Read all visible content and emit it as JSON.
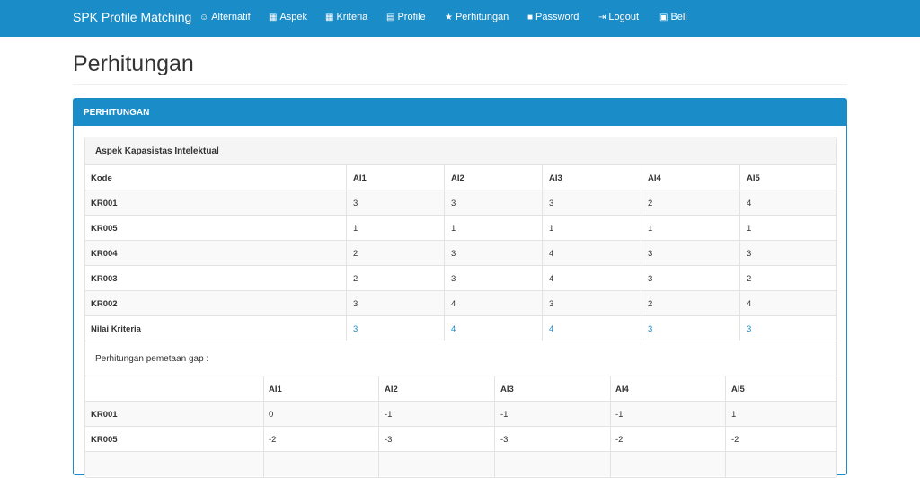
{
  "navbar": {
    "brand": "SPK Profile Matching",
    "items": [
      {
        "icon": "user-icon",
        "glyph": "☺",
        "label": "Alternatif"
      },
      {
        "icon": "grid-icon",
        "glyph": "▦",
        "label": "Aspek"
      },
      {
        "icon": "th-icon",
        "glyph": "▦",
        "label": "Kriteria"
      },
      {
        "icon": "profile-icon",
        "glyph": "▤",
        "label": "Profile"
      },
      {
        "icon": "star-icon",
        "glyph": "★",
        "label": "Perhitungan"
      },
      {
        "icon": "lock-icon",
        "glyph": "■",
        "label": "Password"
      },
      {
        "icon": "logout-icon",
        "glyph": "⇥",
        "label": "Logout"
      },
      {
        "icon": "cart-icon",
        "glyph": "▣",
        "label": "Beli"
      }
    ]
  },
  "page": {
    "title": "Perhitungan"
  },
  "panel": {
    "heading": "PERHITUNGAN",
    "section_title": "Aspek Kapasistas Intelektual",
    "table1": {
      "headers": [
        "Kode",
        "AI1",
        "AI2",
        "AI3",
        "AI4",
        "AI5"
      ],
      "rows": [
        {
          "kode": "KR001",
          "values": [
            "3",
            "3",
            "3",
            "2",
            "4"
          ]
        },
        {
          "kode": "KR005",
          "values": [
            "1",
            "1",
            "1",
            "1",
            "1"
          ]
        },
        {
          "kode": "KR004",
          "values": [
            "2",
            "3",
            "4",
            "3",
            "3"
          ]
        },
        {
          "kode": "KR003",
          "values": [
            "2",
            "3",
            "4",
            "3",
            "2"
          ]
        },
        {
          "kode": "KR002",
          "values": [
            "3",
            "4",
            "3",
            "2",
            "4"
          ]
        }
      ],
      "nilai": {
        "label": "Nilai Kriteria",
        "values": [
          "3",
          "4",
          "4",
          "3",
          "3"
        ]
      }
    },
    "gap_label": "Perhitungan pemetaan gap :",
    "table2": {
      "headers": [
        "",
        "AI1",
        "AI2",
        "AI3",
        "AI4",
        "AI5"
      ],
      "rows": [
        {
          "kode": "KR001",
          "values": [
            "0",
            "-1",
            "-1",
            "-1",
            "1"
          ]
        },
        {
          "kode": "KR005",
          "values": [
            "-2",
            "-3",
            "-3",
            "-2",
            "-2"
          ]
        }
      ]
    }
  }
}
